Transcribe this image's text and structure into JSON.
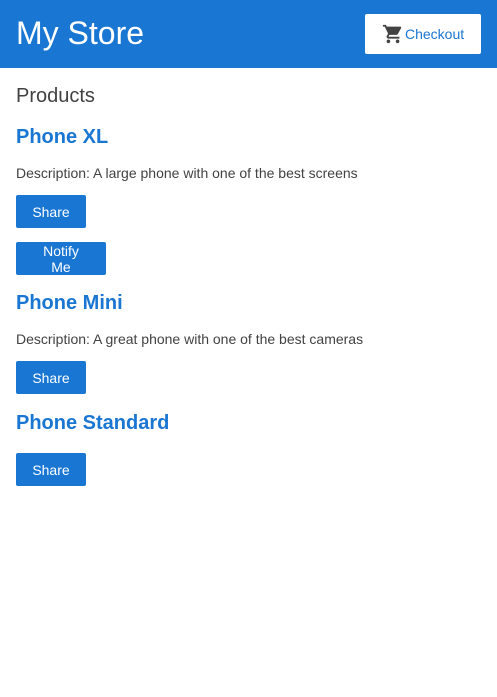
{
  "topbar": {
    "title": "My Store",
    "checkout_label": "Checkout",
    "checkout_icon": "shopping-cart-icon"
  },
  "main": {
    "heading": "Products",
    "products": [
      {
        "name": "Phone XL",
        "description": "Description: A large phone with one of the best screens",
        "share_label": "Share",
        "notify_label": "Notify Me"
      },
      {
        "name": "Phone Mini",
        "description": "Description: A great phone with one of the best cameras",
        "share_label": "Share"
      },
      {
        "name": "Phone Standard",
        "share_label": "Share"
      }
    ]
  },
  "colors": {
    "primary": "#1976d2",
    "text": "#424242",
    "background": "#ffffff"
  }
}
